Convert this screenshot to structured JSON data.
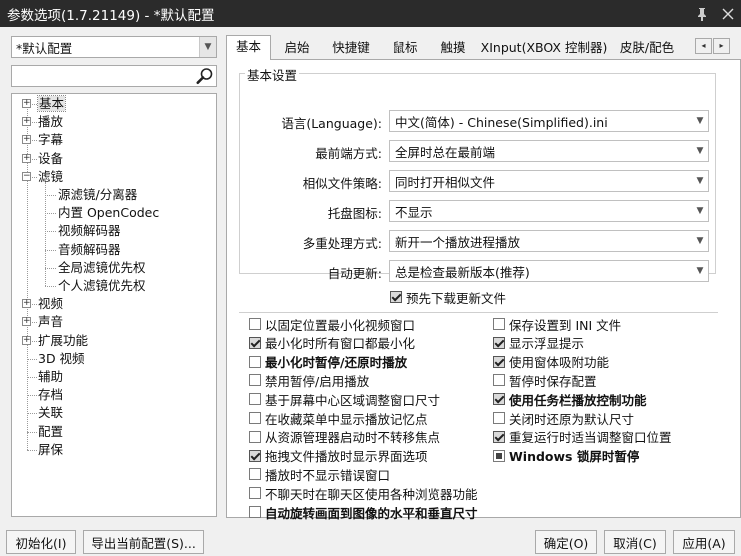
{
  "window": {
    "title": "参数选项(1.7.21149) - *默认配置",
    "pin_icon": "pin-icon",
    "close_icon": "close-icon"
  },
  "profile": {
    "selected": "*默认配置"
  },
  "search": {
    "value": "",
    "icon": "search-icon"
  },
  "tree": {
    "items": [
      {
        "label": "基本",
        "expander": "+"
      },
      {
        "label": "播放",
        "expander": "+"
      },
      {
        "label": "字幕",
        "expander": "+"
      },
      {
        "label": "设备",
        "expander": "+"
      },
      {
        "label": "滤镜",
        "expander": "−"
      },
      {
        "label": "源滤镜/分离器"
      },
      {
        "label": "内置 OpenCodec"
      },
      {
        "label": "视频解码器"
      },
      {
        "label": "音频解码器"
      },
      {
        "label": "全局滤镜优先权"
      },
      {
        "label": "个人滤镜优先权"
      },
      {
        "label": "视频",
        "expander": "+"
      },
      {
        "label": "声音",
        "expander": "+"
      },
      {
        "label": "扩展功能",
        "expander": "+"
      },
      {
        "label": "3D 视频"
      },
      {
        "label": "辅助"
      },
      {
        "label": "存档"
      },
      {
        "label": "关联"
      },
      {
        "label": "配置"
      },
      {
        "label": "屏保"
      }
    ]
  },
  "tabs": [
    {
      "label": "基本"
    },
    {
      "label": "启始"
    },
    {
      "label": "快捷键"
    },
    {
      "label": "鼠标"
    },
    {
      "label": "触摸"
    },
    {
      "label": "XInput(XBOX 控制器)"
    },
    {
      "label": "皮肤/配色"
    }
  ],
  "tab_scroll": {
    "left": "◂",
    "right": "▸"
  },
  "basic": {
    "group_title": "基本设置",
    "rows": [
      {
        "label": "语言(Language):",
        "value": "中文(简体) - Chinese(Simplified).ini"
      },
      {
        "label": "最前端方式:",
        "value": "全屏时总在最前端"
      },
      {
        "label": "相似文件策略:",
        "value": "同时打开相似文件"
      },
      {
        "label": "托盘图标:",
        "value": "不显示"
      },
      {
        "label": "多重处理方式:",
        "value": "新开一个播放进程播放"
      },
      {
        "label": "自动更新:",
        "value": "总是检查最新版本(推荐)"
      }
    ],
    "predownload": {
      "label": "预先下载更新文件",
      "checked": true
    }
  },
  "options_left": [
    {
      "label": "以固定位置最小化视频窗口",
      "state": "unchecked"
    },
    {
      "label": "最小化时所有窗口都最小化",
      "state": "checked"
    },
    {
      "label": "最小化时暂停/还原时播放",
      "state": "unchecked",
      "bold": true
    },
    {
      "label": "禁用暂停/启用播放",
      "state": "unchecked"
    },
    {
      "label": "基于屏幕中心区域调整窗口尺寸",
      "state": "unchecked"
    },
    {
      "label": "在收藏菜单中显示播放记忆点",
      "state": "unchecked"
    },
    {
      "label": "从资源管理器启动时不转移焦点",
      "state": "unchecked"
    },
    {
      "label": "拖拽文件播放时显示界面选项",
      "state": "checked"
    },
    {
      "label": "播放时不显示错误窗口",
      "state": "unchecked"
    },
    {
      "label": "不聊天时在聊天区使用各种浏览器功能",
      "state": "unchecked"
    },
    {
      "label": "自动旋转画面到图像的水平和垂直尺寸",
      "state": "unchecked",
      "bold": true
    }
  ],
  "options_right": [
    {
      "label": "保存设置到 INI 文件",
      "state": "unchecked"
    },
    {
      "label": "显示浮显提示",
      "state": "checked"
    },
    {
      "label": "使用窗体吸附功能",
      "state": "checked"
    },
    {
      "label": "暂停时保存配置",
      "state": "unchecked"
    },
    {
      "label": "使用任务栏播放控制功能",
      "state": "checked",
      "bold": true
    },
    {
      "label": "关闭时还原为默认尺寸",
      "state": "unchecked"
    },
    {
      "label": "重复运行时适当调整窗口位置",
      "state": "checked"
    },
    {
      "label": "Windows 锁屏时暂停",
      "state": "indeterminate",
      "bold": true
    }
  ],
  "buttons": {
    "init": "初始化(I)",
    "export": "导出当前配置(S)...",
    "ok": "确定(O)",
    "cancel": "取消(C)",
    "apply": "应用(A)"
  }
}
